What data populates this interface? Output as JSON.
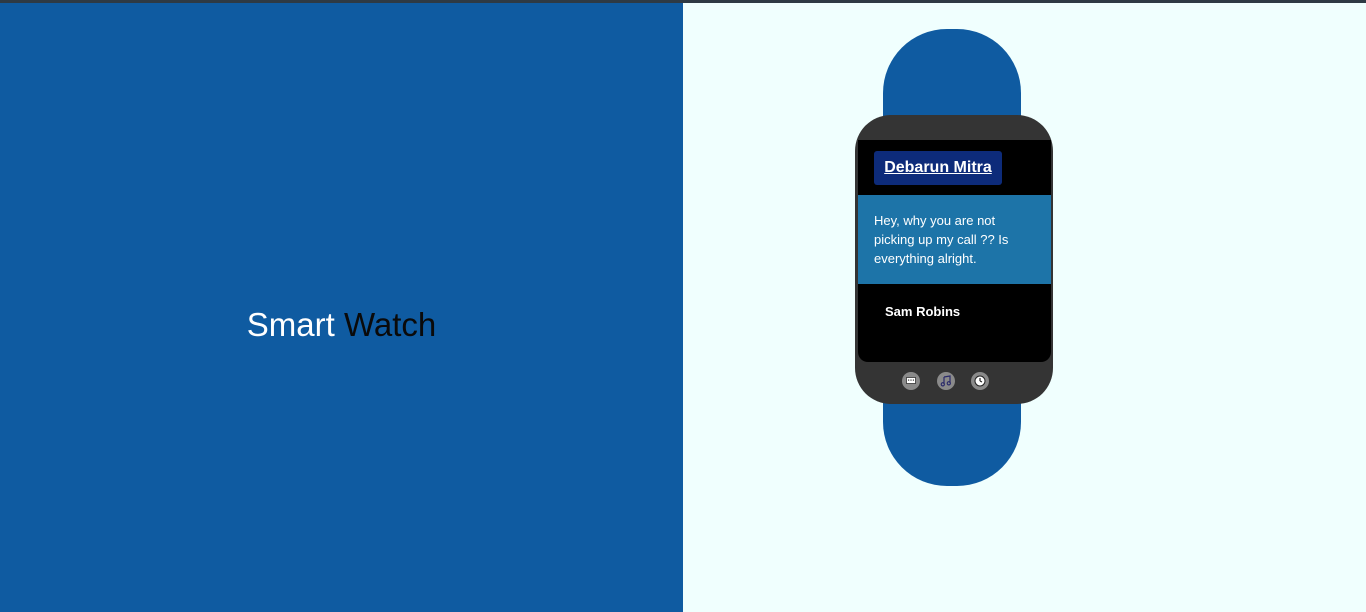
{
  "hero": {
    "word1": "Smart",
    "word2": "Watch"
  },
  "watch": {
    "sender_name": "Debarun Mitra",
    "message": "Hey, why you are not picking up my call ?? Is everything alright.",
    "contact_name": "Sam Robins",
    "bottom_icons": [
      "message-icon",
      "music-icon",
      "clock-icon"
    ]
  },
  "colors": {
    "primary_blue": "#0f5ba1",
    "background": "#f0fffe",
    "watch_body": "#343434",
    "sender_bg": "#0d2b7a",
    "message_bg": "#1d74a8"
  }
}
